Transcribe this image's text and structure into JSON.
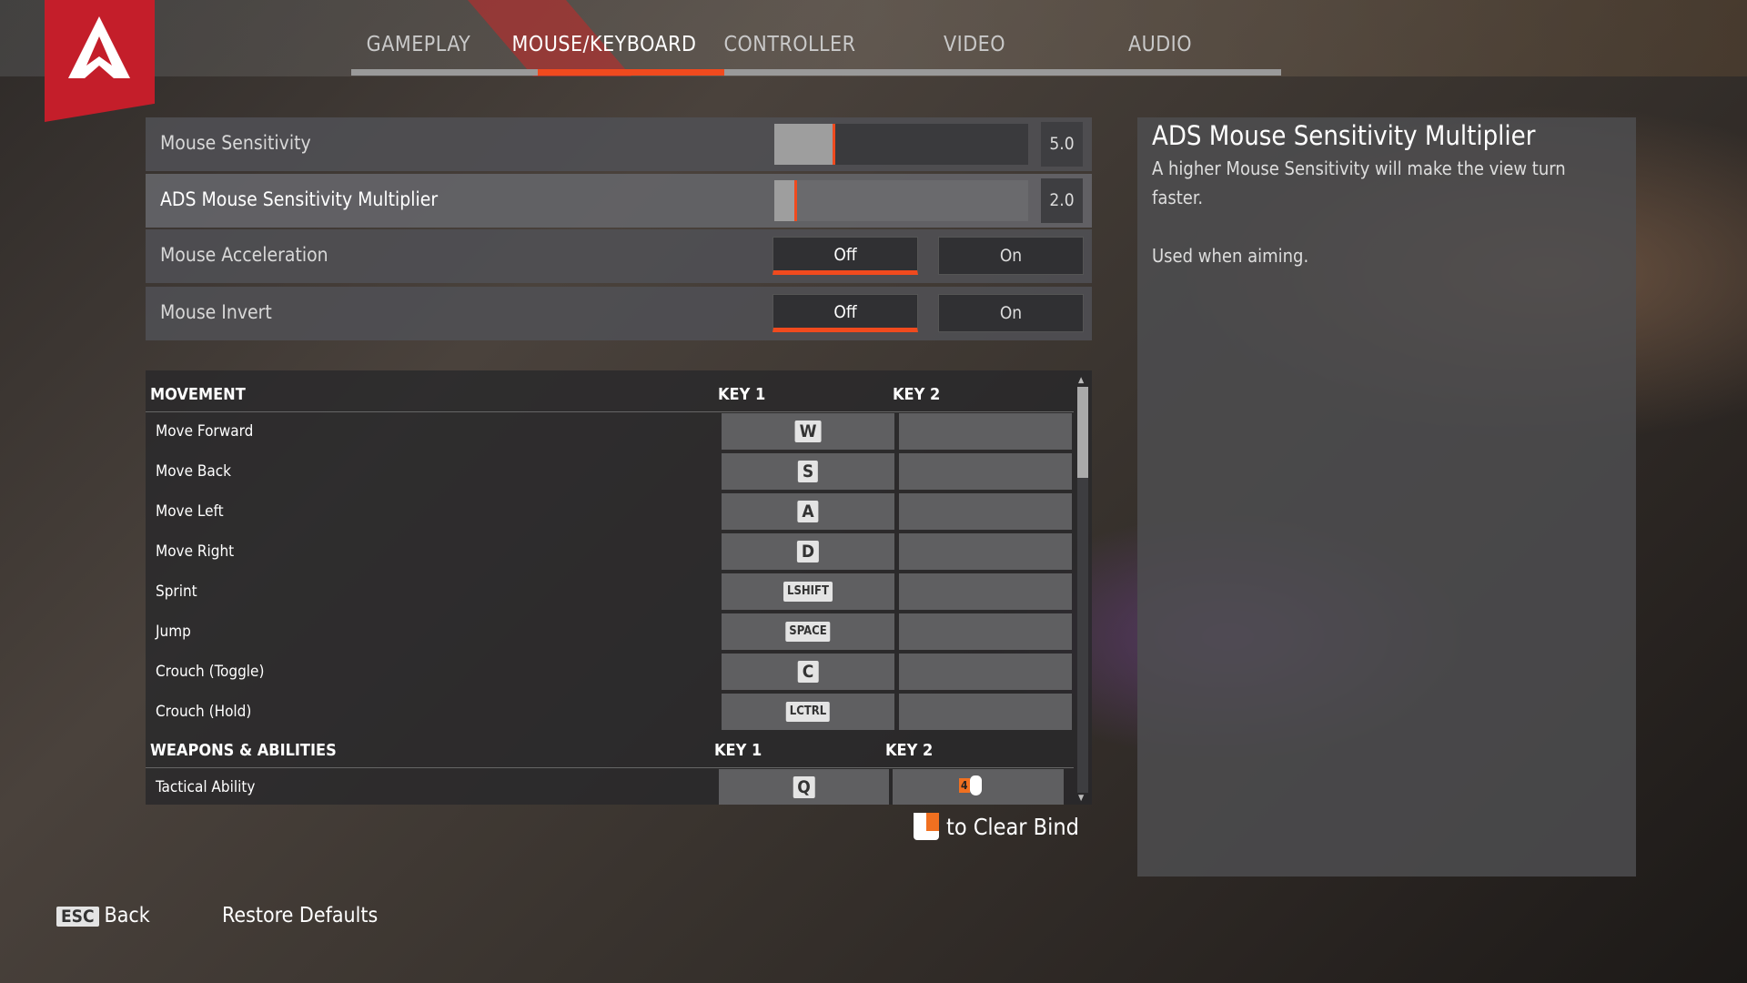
{
  "tabs": [
    {
      "label": "GAMEPLAY",
      "active": false
    },
    {
      "label": "MOUSE/KEYBOARD",
      "active": true
    },
    {
      "label": "CONTROLLER",
      "active": false
    },
    {
      "label": "VIDEO",
      "active": false
    },
    {
      "label": "AUDIO",
      "active": false
    }
  ],
  "settings": {
    "mouse_sensitivity": {
      "label": "Mouse Sensitivity",
      "value": "5.0",
      "fill_fraction": 0.23
    },
    "ads_multiplier": {
      "label": "ADS Mouse Sensitivity Multiplier",
      "value": "2.0",
      "fill_fraction": 0.08
    },
    "mouse_acceleration": {
      "label": "Mouse Acceleration",
      "off": "Off",
      "on": "On",
      "selected": "Off"
    },
    "mouse_invert": {
      "label": "Mouse Invert",
      "off": "Off",
      "on": "On",
      "selected": "Off"
    }
  },
  "movement": {
    "title": "MOVEMENT",
    "key1": "KEY 1",
    "key2": "KEY 2",
    "rows": [
      {
        "action": "Move Forward",
        "key1": "W",
        "key2": ""
      },
      {
        "action": "Move Back",
        "key1": "S",
        "key2": ""
      },
      {
        "action": "Move Left",
        "key1": "A",
        "key2": ""
      },
      {
        "action": "Move Right",
        "key1": "D",
        "key2": ""
      },
      {
        "action": "Sprint",
        "key1": "LSHIFT",
        "key2": ""
      },
      {
        "action": "Jump",
        "key1": "SPACE",
        "key2": ""
      },
      {
        "action": "Crouch (Toggle)",
        "key1": "C",
        "key2": ""
      },
      {
        "action": "Crouch (Hold)",
        "key1": "LCTRL",
        "key2": ""
      }
    ]
  },
  "weapons": {
    "title": "WEAPONS & ABILITIES",
    "key1": "KEY 1",
    "key2": "KEY 2",
    "rows": [
      {
        "action": "Tactical Ability",
        "key1": "Q",
        "key2_icon": "mouse-button-4-icon",
        "key2_num": "4"
      }
    ]
  },
  "clear_bind": "to Clear Bind",
  "info": {
    "title": "ADS Mouse Sensitivity Multiplier",
    "desc": "A higher Mouse Sensitivity will make the view turn faster.",
    "note": "Used when aiming."
  },
  "footer": {
    "esc_key": "ESC",
    "back": "Back",
    "restore": "Restore Defaults"
  },
  "colors": {
    "accent": "#f04a1e",
    "logo": "#c41e2a"
  }
}
